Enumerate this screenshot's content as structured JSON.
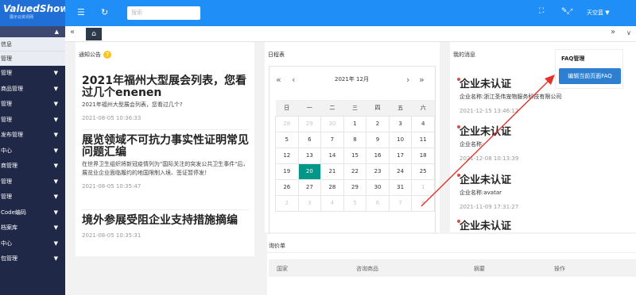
{
  "brand": {
    "name": "ValuedShow",
    "tagline": "展示云资讯网"
  },
  "topbar": {
    "search_placeholder": "搜索",
    "user": "天空蓝",
    "icons": [
      "menu-icon",
      "refresh-icon",
      "fullscreen-icon",
      "clear-icon",
      "expand-icon"
    ]
  },
  "sidebar": {
    "submenu": [
      "信息",
      "管理"
    ],
    "menu": [
      "管理",
      "商品管理",
      "管理",
      "管理",
      "发布管理",
      "中心",
      "商管理",
      "管理",
      "管理",
      "Code编码",
      "档案库",
      "中心",
      "包管理"
    ]
  },
  "tabs": {
    "home_icon": "home-icon"
  },
  "notice": {
    "title": "通知公告",
    "badge": "7",
    "items": [
      {
        "title": "2021年福州大型展会列表，您看过几个enenen",
        "summary": "2021年福州大型展会列表，您看过几个?",
        "date": "2021-08-05 10:36:33"
      },
      {
        "title": "展览领域不可抗力事实性证明常见问题汇编",
        "summary": "在世界卫生组织将新冠疫情列为\"国际关注的突发公共卫生事件\"后，展览业企业面临履约的地国限制入境、签证暂停发！",
        "date": "2021-08-05 10:35:47"
      },
      {
        "title": "境外参展受阻企业支持措施摘编",
        "summary": "",
        "date": "2021-08-05 10:35:31"
      }
    ]
  },
  "calendar": {
    "title": "日程表",
    "header": "2021年 12月",
    "weekdays": [
      "日",
      "一",
      "二",
      "三",
      "四",
      "五",
      "六"
    ],
    "rows": [
      [
        "28",
        "29",
        "30",
        "1",
        "2",
        "3",
        "4"
      ],
      [
        "5",
        "6",
        "7",
        "8",
        "9",
        "10",
        "11"
      ],
      [
        "12",
        "13",
        "14",
        "15",
        "16",
        "17",
        "18"
      ],
      [
        "19",
        "20",
        "21",
        "22",
        "23",
        "24",
        "25"
      ],
      [
        "26",
        "27",
        "28",
        "29",
        "30",
        "31",
        "1"
      ],
      [
        "2",
        "3",
        "4",
        "5",
        "6",
        "7",
        "8"
      ]
    ],
    "selected": "20"
  },
  "messages": {
    "title": "我的消息",
    "items": [
      {
        "title": "企业未认证",
        "detail": "企业名称:浙江圣伟宠物服务科技有限公司",
        "date": "2021-12-15 13:46:12"
      },
      {
        "title": "企业未认证",
        "detail": "企业名称:",
        "date": "2021-12-08 10:13:39"
      },
      {
        "title": "企业未认证",
        "detail": "企业名称:avatar",
        "date": "2021-11-09 17:31:27"
      },
      {
        "title": "企业未认证",
        "detail": "",
        "date": ""
      }
    ]
  },
  "faq": {
    "title": "FAQ管理",
    "button": "编辑当前页面FAQ"
  },
  "inquiry": {
    "title": "询价单",
    "columns": [
      "国家",
      "咨询商品",
      "摘要",
      "操作"
    ]
  }
}
